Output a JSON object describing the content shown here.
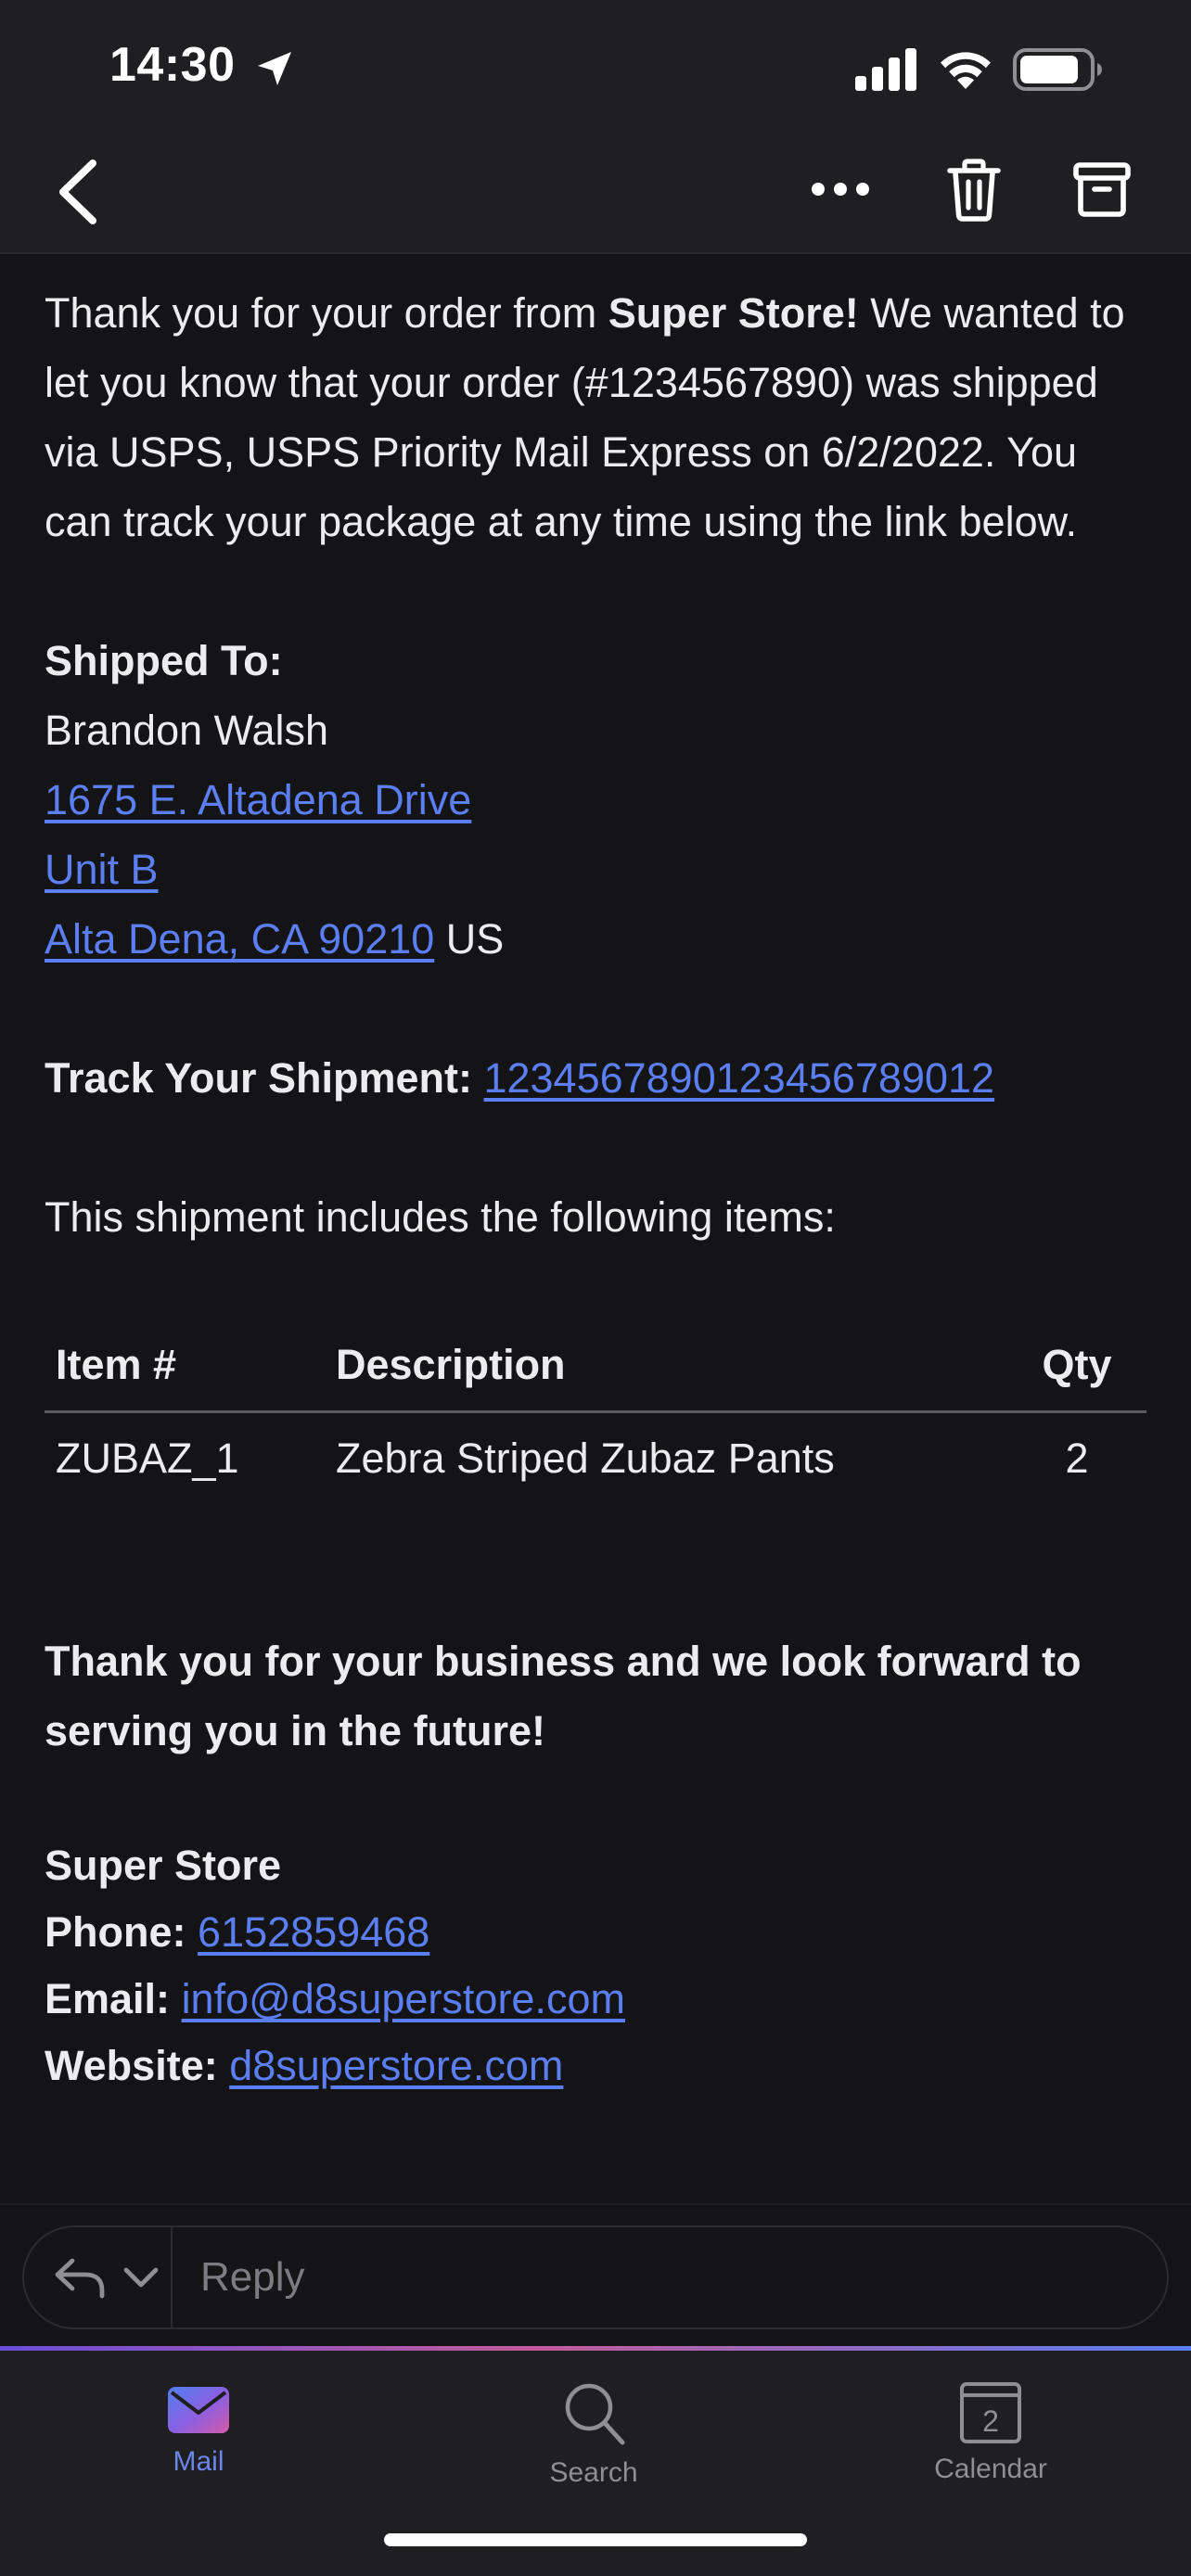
{
  "status_bar": {
    "time": "14:30"
  },
  "email": {
    "intro": {
      "p1": "Thank you for your order from ",
      "store": "Super Store!",
      "p2": " We wanted to let you know that your order (#1234567890) was shipped via USPS, USPS Priority Mail Express on 6/2/2022.  You can track your package at any time using the link below."
    },
    "shipped_to": {
      "label": "Shipped To:",
      "name": "Brandon Walsh",
      "address1": "1675 E. Altadena Drive",
      "address2": "Unit B",
      "city_line": "Alta Dena, CA 90210",
      "country": " US"
    },
    "tracking": {
      "label": "Track Your Shipment:",
      "number": "12345678901234567890​12"
    },
    "items_intro": "This shipment includes the following items:",
    "table": {
      "headers": [
        "Item #",
        "Description",
        "Qty"
      ],
      "rows": [
        {
          "item": "ZUBAZ_1",
          "description": "Zebra Striped Zubaz Pants",
          "qty": "2"
        }
      ]
    },
    "closing": "Thank you for your business and we look forward to serving you in the future!",
    "signature": {
      "store_name": "Super Store",
      "phone_label": "Phone:",
      "phone": "6152859468",
      "email_label": "Email:",
      "email": "info@d8superstore.com",
      "website_label": "Website:",
      "website": "d8superstore.com"
    }
  },
  "reply": {
    "placeholder": "Reply"
  },
  "tabs": [
    {
      "label": "Mail"
    },
    {
      "label": "Search"
    },
    {
      "label": "Calendar",
      "badge": "2"
    }
  ],
  "colors": {
    "link": "#5b7ef2",
    "accent": "#6b84ee",
    "background": "#141416"
  }
}
